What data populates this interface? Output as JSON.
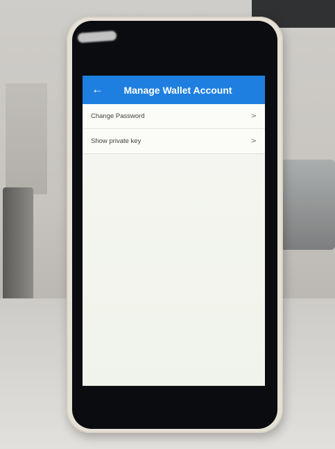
{
  "app_bar": {
    "title": "Manage Wallet Account",
    "back_icon": "arrow-left-icon",
    "color": "#1f7fe0"
  },
  "menu": {
    "items": [
      {
        "label": "Change Password",
        "icon": "chevron-right-icon"
      },
      {
        "label": "Show private key",
        "icon": "chevron-right-icon"
      }
    ]
  },
  "glyphs": {
    "back": "←",
    "chevron": ">"
  }
}
